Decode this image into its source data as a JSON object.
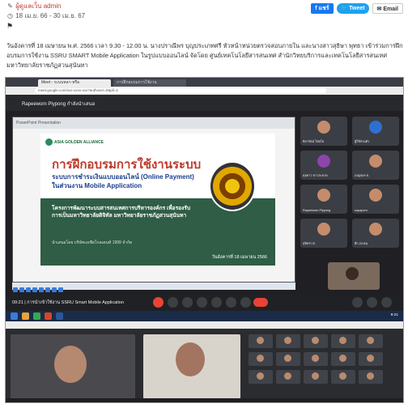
{
  "header": {
    "author": "ผู้ดูแลเว็บ admin",
    "date_range": "18 เม.ย. 66 - 30 เม.ย. 67",
    "share_facebook": "แชร์",
    "share_twitter": "Tweet",
    "share_email": "Email"
  },
  "article": {
    "paragraph": "วันอังคารที่ 18 เมษายน พ.ศ. 2566 เวลา 9.30 - 12.00 น. นางปราณีพร บุญประเภทศรี หัวหน้าหน่วยตรวจสอบภายใน และนางสาวสุธิษา พุทธา เข้าร่วมการฝึกอบรมการใช้งาน SSRU SMART Mobile Application ในรูปแบบออนไลน์ จัดโดย ศูนย์เทคโนโลยีสารสนเทศ สำนักวิทยบริการและเทคโนโลยีสารสนเทศ มหาวิทยาลัยราชภัฏสวนสุนันทา"
  },
  "screenshot": {
    "tabs": [
      "Meet - ระบบหลา-หรือ",
      "การฝึกอบรมการใช้งาน"
    ],
    "url": "meet.google.com/xxx-xxxx-xxx?authuser=0&pli=1",
    "meeting_title": "Rapeeworn Plypong กำลังนำเสนอ",
    "slide": {
      "org": "ASIA GOLDEN ALLIANCE",
      "title": "การฝึกอบรมการใช้งานระบบ",
      "subtitle": "ระบบการชำระเงินแบบออนไลน์ (Online Payment) ในส่วนงาน Mobile Application",
      "body": "โครงการพัฒนาระบบสารสนเทศการบริหารองค์กร เพื่อรองรับการเป็นมหาวิทยาลัยดิจิทัล มหาวิทยาลัยราชภัฏสวนสุนันทา",
      "by": "นำเสนอโดย บริษัทเอเชียโกลเดนท์ 1999 จำกัด",
      "date": "วันอังคารที่ 18 เมษายน 2566"
    },
    "participants": [
      "ธิดารัตน์ ไชยโย",
      "ผู้ใช้ส่วนตัว",
      "ดุจดาว ขาวสะอาด",
      "เบญจพร ธ.",
      "Rapeeworn Plypong",
      "supaporn",
      "สุจิตรา ศ.",
      "อีก 23 คน"
    ],
    "controls_time": "09:21 | การนำเข้าใช้งาน SSRU Smart Mobile Application",
    "clock": "9:21"
  }
}
